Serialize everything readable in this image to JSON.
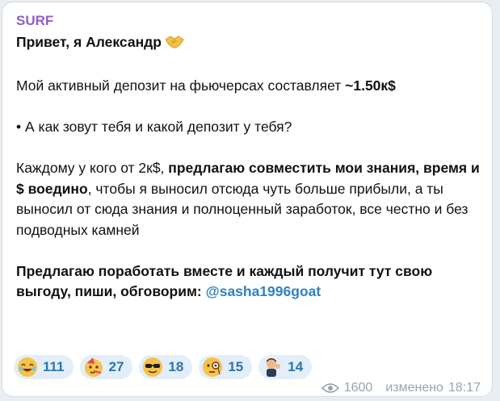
{
  "message": {
    "sender": "SURF",
    "greeting": "Привет, я Александр",
    "line_deposit_prefix": "Мой активный депозит на фьючерсах составляет ",
    "line_deposit_value": "~1.50к$",
    "line_question": "• А как зовут тебя и какой депозит у тебя?",
    "para_prefix": "Каждому у кого от 2к$, ",
    "para_bold": "предлагаю совместить мои знания, время и $ воедино",
    "para_rest": ", чтобы я выносил отсюда чуть больше прибыли, а ты выносил от сюда знания и полноценный заработок, все честно и без подводных камней",
    "closing_bold": "Предлагаю поработать вместе и каждый получит тут свою выгоду, пиши, обговорим: ",
    "mention": "@sasha1996goat"
  },
  "reactions": [
    {
      "icon": "laughing-face-icon",
      "count": "111"
    },
    {
      "icon": "party-face-icon",
      "count": "27"
    },
    {
      "icon": "sunglasses-face-icon",
      "count": "18"
    },
    {
      "icon": "monocle-face-icon",
      "count": "15"
    },
    {
      "icon": "person-gesture-icon",
      "count": "14"
    }
  ],
  "footer": {
    "views": "1600",
    "edited_label": "изменено",
    "time": "18:17"
  },
  "colors": {
    "sender": "#8e5fc2",
    "mention": "#2f82c4",
    "reaction_bg": "#e3eef8",
    "reaction_text": "#2a75b5",
    "meta_text": "#9aa4ad"
  }
}
